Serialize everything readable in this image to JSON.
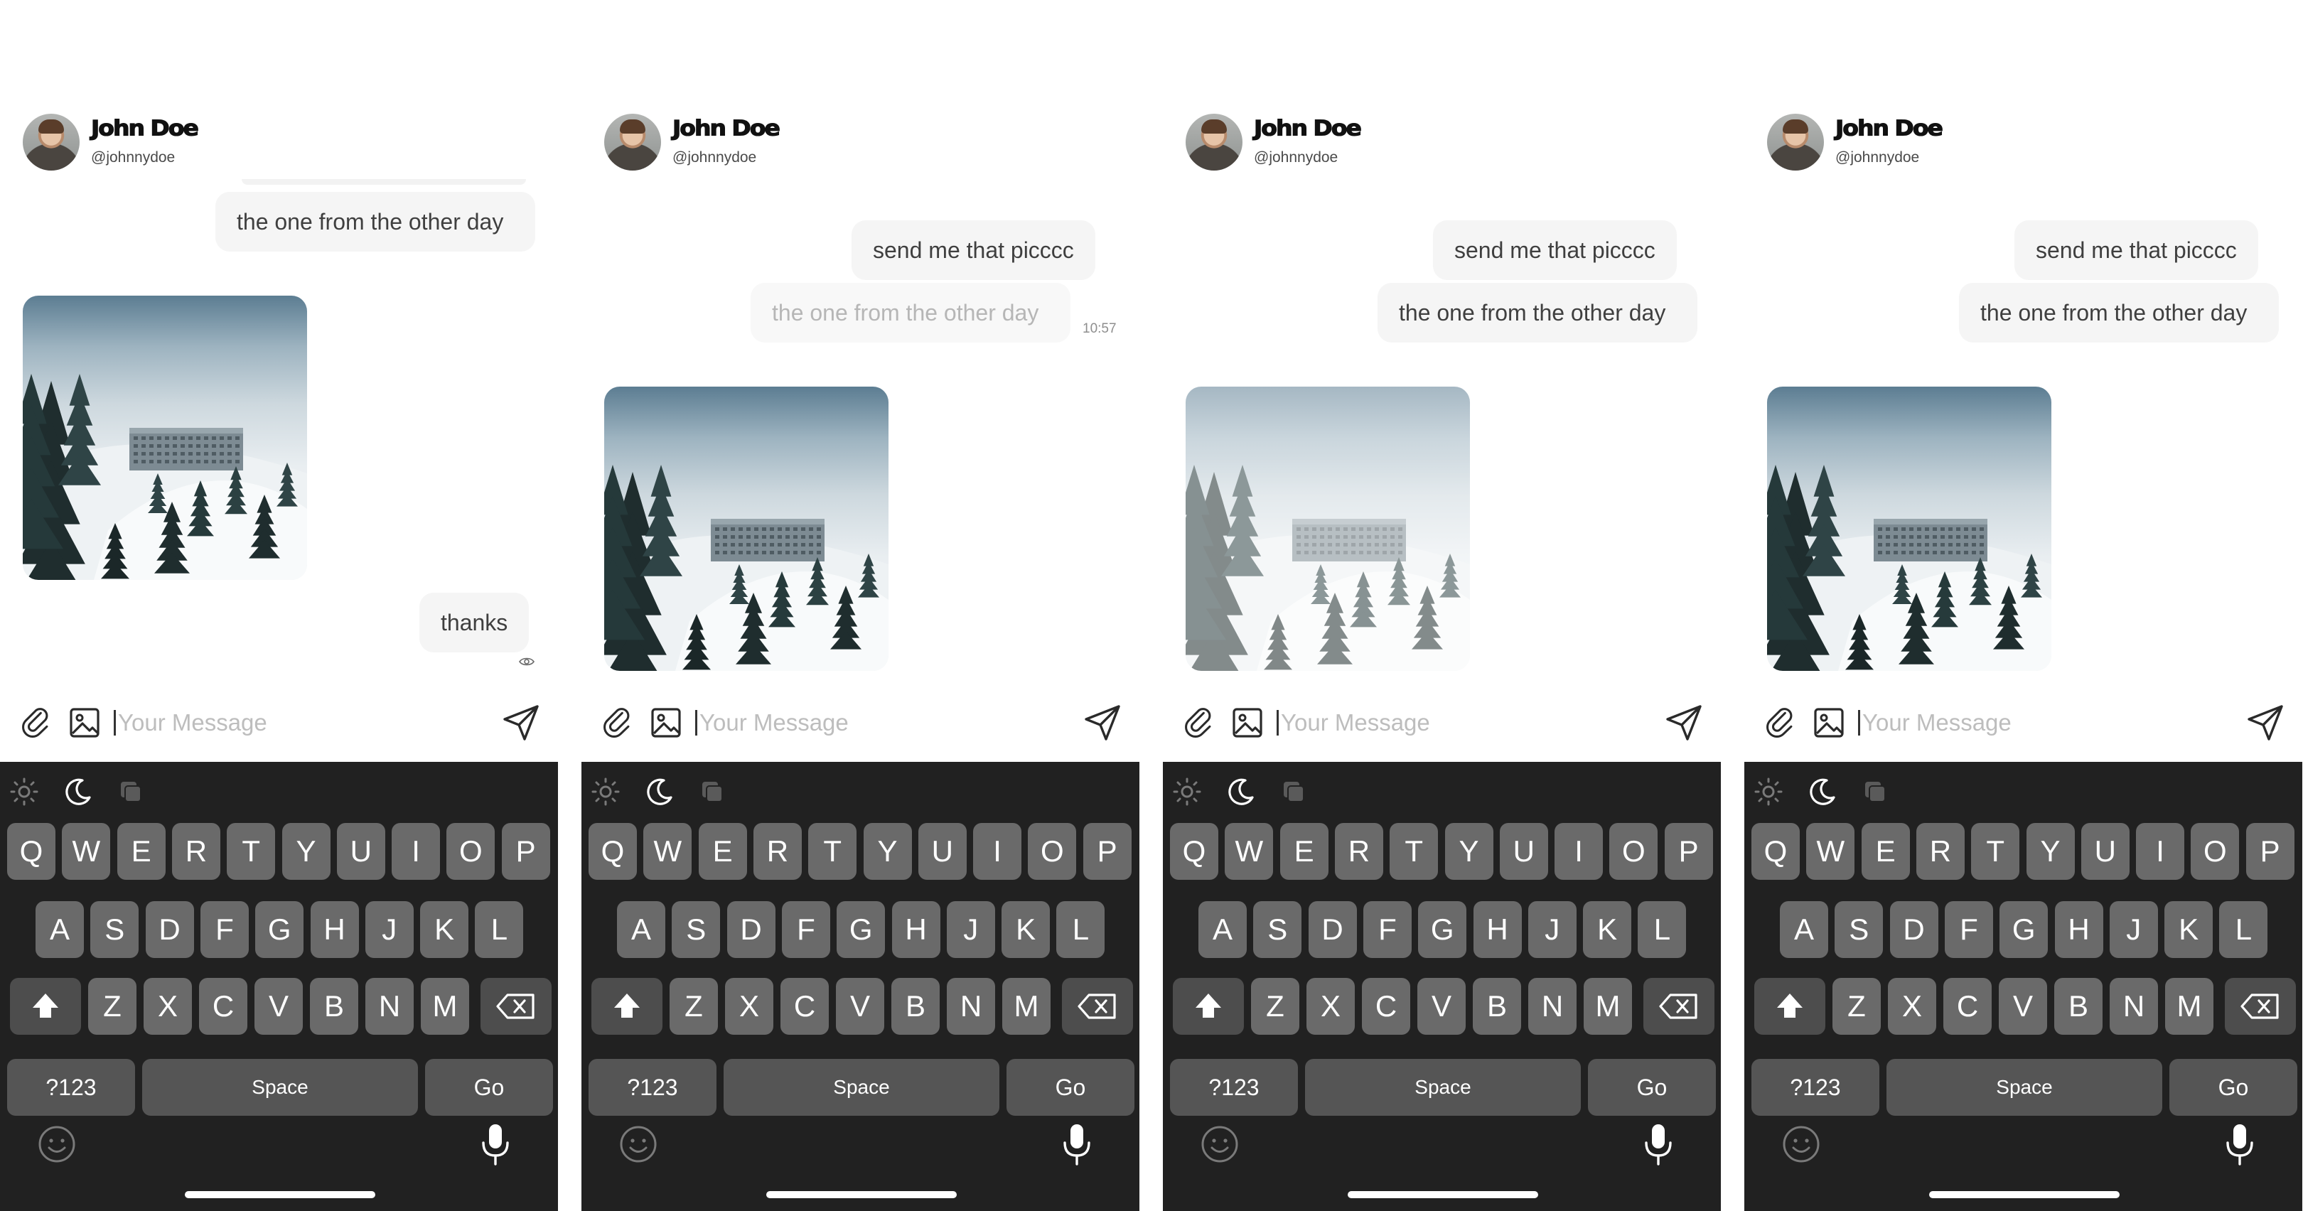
{
  "contact": {
    "name": "John Doe",
    "handle": "@johnnydoe"
  },
  "composer": {
    "placeholder": "Your Message"
  },
  "screens": [
    {
      "messages": [
        {
          "type": "text",
          "text": "the one from the other day"
        },
        {
          "type": "image",
          "alt": "Snowy mountain hotel among pine trees"
        },
        {
          "type": "text",
          "text": "thanks",
          "status": "seen"
        }
      ]
    },
    {
      "messages": [
        {
          "type": "text",
          "text": "send me that picccc"
        },
        {
          "type": "text",
          "text": "the one from the other day",
          "state": "sending",
          "time": "10:57"
        },
        {
          "type": "image",
          "alt": "Snowy mountain hotel among pine trees"
        }
      ]
    },
    {
      "messages": [
        {
          "type": "text",
          "text": "send me that picccc"
        },
        {
          "type": "text",
          "text": "the one from the other day"
        },
        {
          "type": "image",
          "alt": "Snowy mountain hotel among pine trees",
          "state": "uploading"
        }
      ]
    },
    {
      "messages": [
        {
          "type": "text",
          "text": "send me that picccc"
        },
        {
          "type": "text",
          "text": "the one from the other day"
        },
        {
          "type": "image",
          "alt": "Snowy mountain hotel among pine trees"
        }
      ]
    }
  ],
  "keyboard": {
    "row1": [
      "Q",
      "W",
      "E",
      "R",
      "T",
      "Y",
      "U",
      "I",
      "O",
      "P"
    ],
    "row2": [
      "A",
      "S",
      "D",
      "F",
      "G",
      "H",
      "J",
      "K",
      "L"
    ],
    "row3": [
      "Z",
      "X",
      "C",
      "V",
      "B",
      "N",
      "M"
    ],
    "numbers_label": "?123",
    "space_label": "Space",
    "go_label": "Go",
    "tools": [
      "light-mode-icon",
      "dark-mode-icon",
      "clipboard-icon"
    ]
  }
}
